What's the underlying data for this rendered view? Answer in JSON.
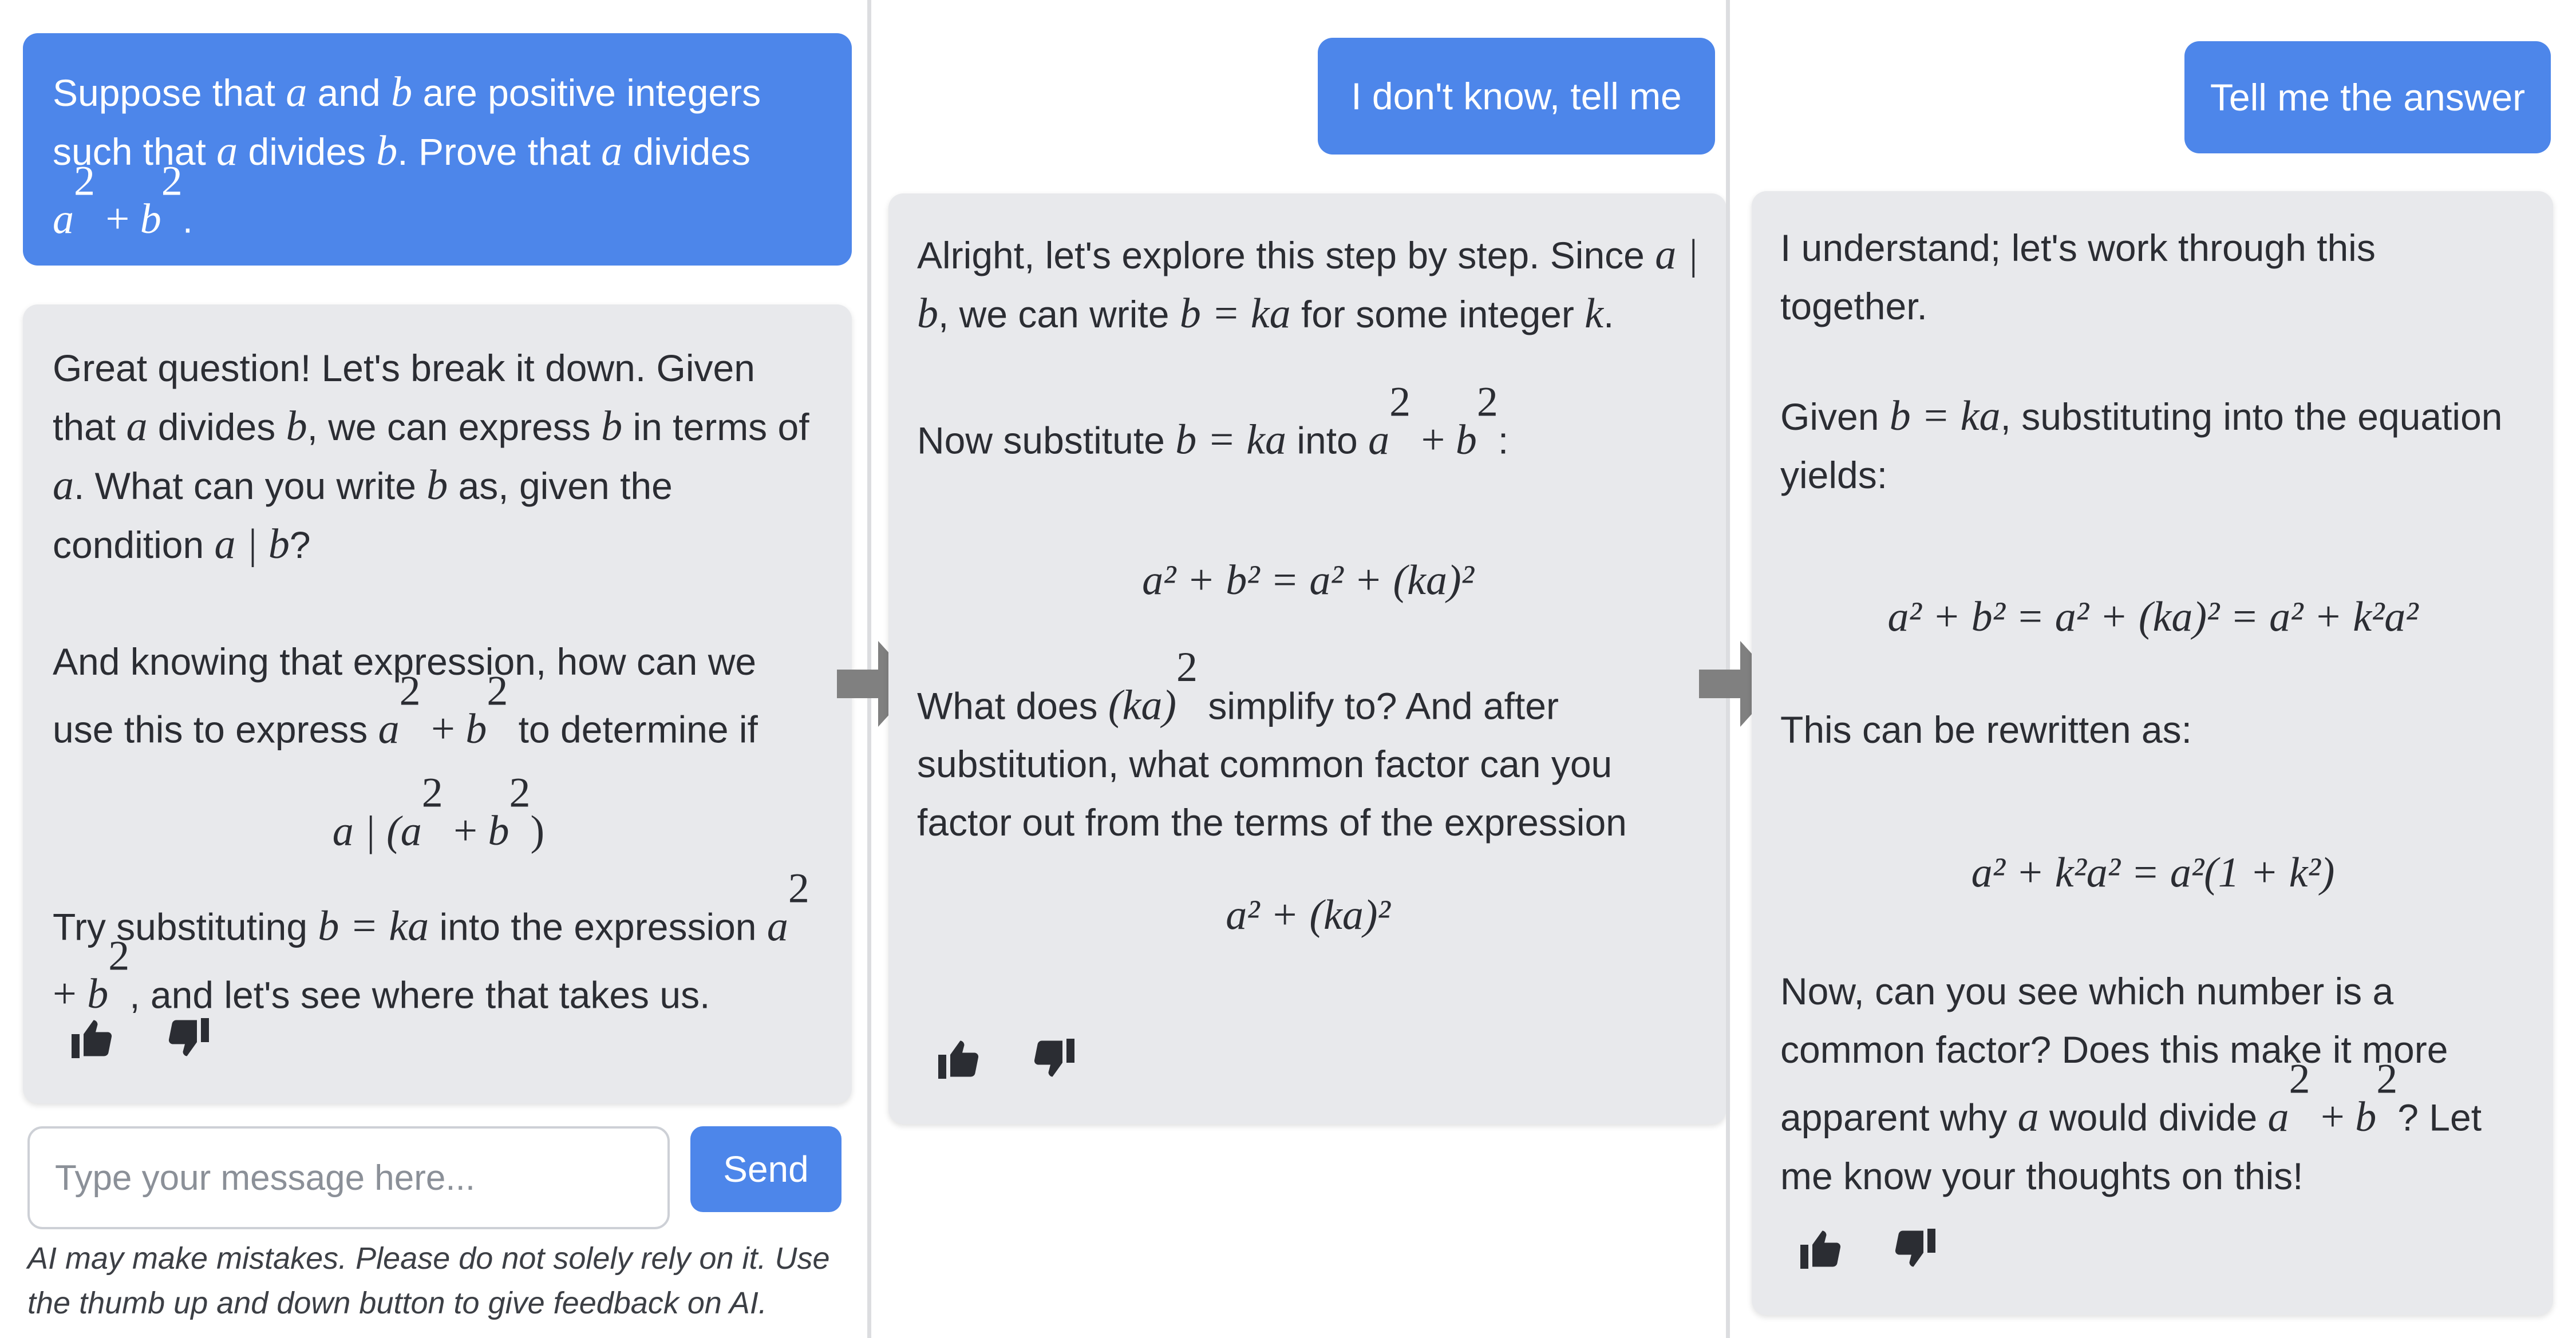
{
  "panel1": {
    "user": {
      "text_a": "Suppose that ",
      "text_b": " and ",
      "text_c": " are positive integers such that ",
      "text_d": " divides ",
      "text_e": ". Prove that ",
      "text_f": " divides",
      "text_g": "."
    },
    "ai": {
      "p1_a": "Great question! Let's break it down. Given that ",
      "p1_b": " divides ",
      "p1_c": ", we can express ",
      "p1_d": " in terms of ",
      "p1_e": ". What can you write ",
      "p1_f": " as, given the condition ",
      "p1_g": "?",
      "p2_a": "And knowing that expression, how can we use this to express ",
      "p2_b": " to determine if",
      "p3_a": "Try substituting ",
      "p3_b": " into the expression ",
      "p3_c": ", and let's see where that takes us."
    },
    "input_placeholder": "Type your message here...",
    "send_label": "Send",
    "disclaimer": "AI may make mistakes. Please do not solely rely on it. Use the thumb up and down button to give feedback on AI."
  },
  "panel2": {
    "user": {
      "text": "I don't know, tell me"
    },
    "ai": {
      "p1_a": "Alright, let's explore this step by step. Since ",
      "p1_b": ", we can write ",
      "p1_c": " for some integer ",
      "p1_d": ".",
      "p2_a": "Now substitute ",
      "p2_b": " into ",
      "p2_c": ":",
      "p3_a": "What does ",
      "p3_b": " simplify to? And after substitution, what common factor can you factor out from the terms of the expression"
    }
  },
  "panel3": {
    "user": {
      "text": "Tell me the answer"
    },
    "ai": {
      "p1": "I understand; let's work through this together.",
      "p2_a": "Given ",
      "p2_b": ", substituting into the equation yields:",
      "p3": "This can be rewritten as:",
      "p4_a": "Now, can you see which number is a common factor? Does this make it more apparent why ",
      "p4_b": " would divide ",
      "p4_c": "? Let me know your thoughts on this!"
    }
  },
  "math": {
    "a": "a",
    "b": "b",
    "k": "k",
    "b_eq_ka": "b = ka",
    "a_div_b": "a | b",
    "ka_sq": "(ka)",
    "disp_a_div": "a | (a",
    "disp_p2_eq": "a² + b² = a² + (ka)²",
    "disp_p2_expr": "a² + (ka)²",
    "disp_p3_eq1": "a² + b² = a² + (ka)² = a² + k²a²",
    "disp_p3_eq2": "a² + k²a² = a²(1 + k²)"
  },
  "icons": [
    "thumbs-up-icon",
    "thumbs-down-icon",
    "right-arrow-icon"
  ],
  "colors": {
    "user_bubble": "#4d86ea",
    "ai_bubble": "#e8e9ec",
    "send_button": "#4d86ea",
    "arrow": "#808080"
  }
}
